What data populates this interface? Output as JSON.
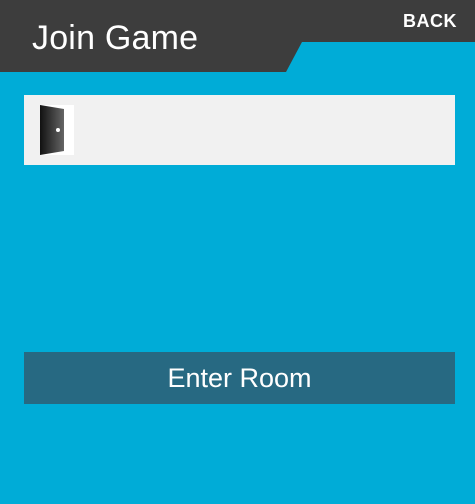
{
  "header": {
    "title": "Join Game",
    "back_label": "BACK"
  },
  "room_input": {
    "value": "",
    "placeholder": "",
    "icon": "door-icon"
  },
  "actions": {
    "enter_label": "Enter Room"
  },
  "colors": {
    "background": "#00acd7",
    "header": "#3d3d3d",
    "input_bg": "#f1f1f1",
    "button": "#276982",
    "text": "#ffffff"
  }
}
